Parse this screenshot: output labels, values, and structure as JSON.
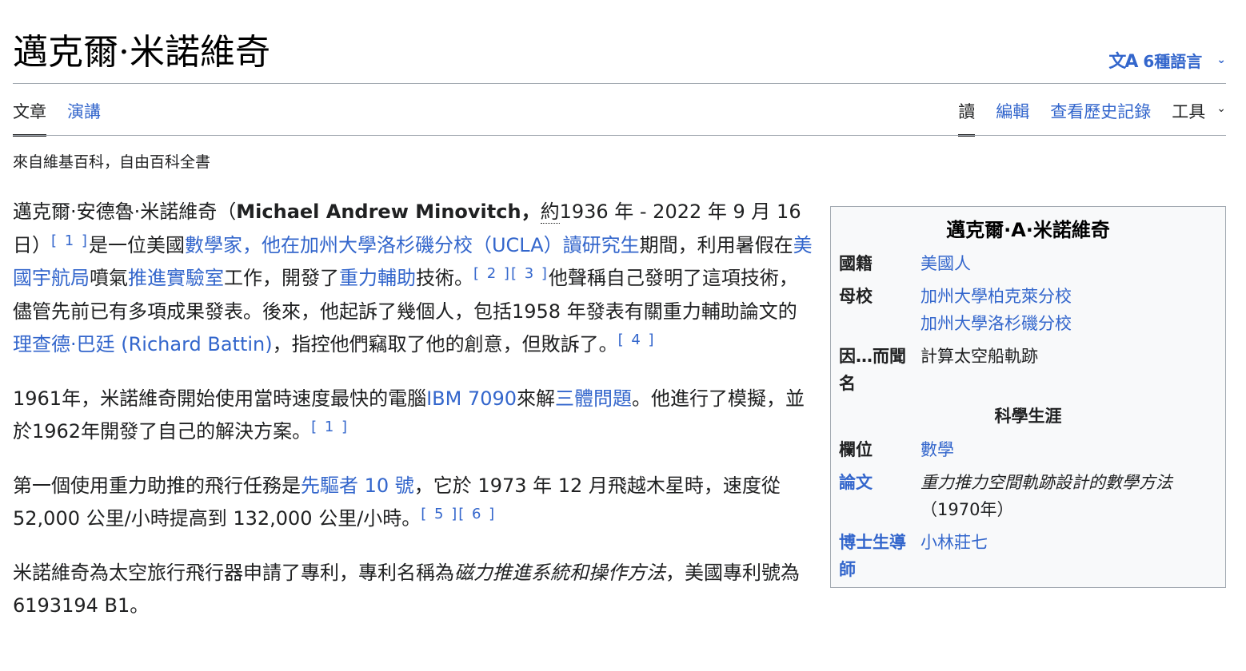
{
  "page": {
    "title": "邁克爾·米諾維奇",
    "language_button": {
      "icon": "translate-icon",
      "icon_text": "文A",
      "label": "6種語言"
    },
    "tagline": "來自維基百科，自由百科全書"
  },
  "tabs_left": [
    {
      "label": "文章",
      "active": true
    },
    {
      "label": "演講",
      "active": false
    }
  ],
  "tabs_right": [
    {
      "label": "讀",
      "active": true
    },
    {
      "label": "編輯",
      "active": false
    },
    {
      "label": "查看歷史記錄",
      "active": false
    },
    {
      "label": "工具",
      "active": false
    }
  ],
  "article": {
    "p1": {
      "t1": "邁克爾·安德魯·米諾維奇（",
      "name_en": "Michael Andrew Minovitch，",
      "approx": "約",
      "t2": "1936 年 - 2022 年 9 月 16 日）",
      "ref1": "[ 1 ]",
      "t3": "是一位美國",
      "link1": "數學家，他在加州大學洛杉磯分校（UCLA）讀研究生",
      "t4": "期間，利用暑假在",
      "link2": "美國宇航局",
      "t5": "噴氣",
      "link3": "推進實驗室",
      "t6": "工作，開發了",
      "link4": "重力輔助",
      "t7": "技術。",
      "ref2": "[ 2 ]",
      "ref3": "[ 3 ]",
      "t8": "他聲稱自己發明了這項技術，儘管先前已有多項成果發表。後來，他起訴了幾個人，包括1958 年發表有關重力輔助論文的",
      "link5": "理查德·巴廷 (Richard Battin)",
      "t9": "，指控他們竊取了他的創意，但敗訴了。",
      "ref4": "[ 4 ]"
    },
    "p2": {
      "t1": "1961年，米諾維奇開始使用當時速度最快的電腦",
      "link1": "IBM 7090",
      "t2": "來解",
      "link2": "三體問題",
      "t3": "。他進行了模擬，並於1962年開發了自己的解決方案。",
      "ref1": "[ 1 ]"
    },
    "p3": {
      "t1": "第一個使用重力助推的飛行任務是",
      "link1": "先驅者 10 號",
      "t2": "，它於 1973 年 12 月飛越木星時，速度從 52,000 公里/小時提高到 132,000 公里/小時。",
      "ref1": "[ 5 ]",
      "ref2": "[ 6 ]"
    },
    "p4": {
      "t1": "米諾維奇為太空旅行飛行器申請了專利，專利名稱為",
      "italic": "磁力推進系統和操作方法",
      "t2": "，美國專利號為 6193194 B1。"
    }
  },
  "infobox": {
    "title": "邁克爾·A·米諾維奇",
    "nationality_label": "國籍",
    "nationality_value": "美國人",
    "alma_label": "母校",
    "alma_values": [
      "加州大學柏克萊分校",
      "加州大學洛杉磯分校"
    ],
    "known_label": "因…而聞名",
    "known_value": "計算太空船軌跡",
    "section": "科學生涯",
    "field_label": "欄位",
    "field_value": "數學",
    "thesis_label": "論文",
    "thesis_title": "重力推力空間軌跡設計的數學方法",
    "thesis_year": "（1970年）",
    "advisor_label": "博士生導師",
    "advisor_value": "小林莊七"
  },
  "colors": {
    "link": "#3366cc",
    "text": "#202122",
    "border": "#a2a9b1",
    "infobox_bg": "#f8f9fa"
  }
}
